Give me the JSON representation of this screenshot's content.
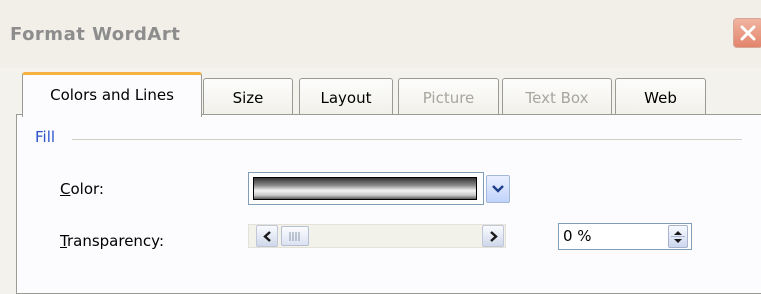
{
  "dialog": {
    "title": "Format WordArt"
  },
  "tabs": [
    {
      "label": "Colors and Lines",
      "active": true,
      "enabled": true
    },
    {
      "label": "Size",
      "active": false,
      "enabled": true
    },
    {
      "label": "Layout",
      "active": false,
      "enabled": true
    },
    {
      "label": "Picture",
      "active": false,
      "enabled": false
    },
    {
      "label": "Text Box",
      "active": false,
      "enabled": false
    },
    {
      "label": "Web",
      "active": false,
      "enabled": true
    }
  ],
  "fill": {
    "section_label": "Fill",
    "color_label_mnemonic": "C",
    "color_label_rest": "olor:",
    "transparency_label_mnemonic": "T",
    "transparency_label_rest": "ransparency:",
    "transparency_value": "0 %",
    "transparency_fraction": 0
  },
  "colors": {
    "section_blue": "#2b54cc",
    "active_tab_accent": "#f6b140",
    "close_button": "#e3846b",
    "disabled_text": "#a7a69e"
  },
  "icons": {
    "close": "close-x-icon",
    "dropdown": "chevron-down-icon",
    "scroll_left": "arrow-left-icon",
    "scroll_right": "arrow-right-icon",
    "thumb_grip": "grip-icon",
    "spin": "spin-up-down-icon"
  }
}
